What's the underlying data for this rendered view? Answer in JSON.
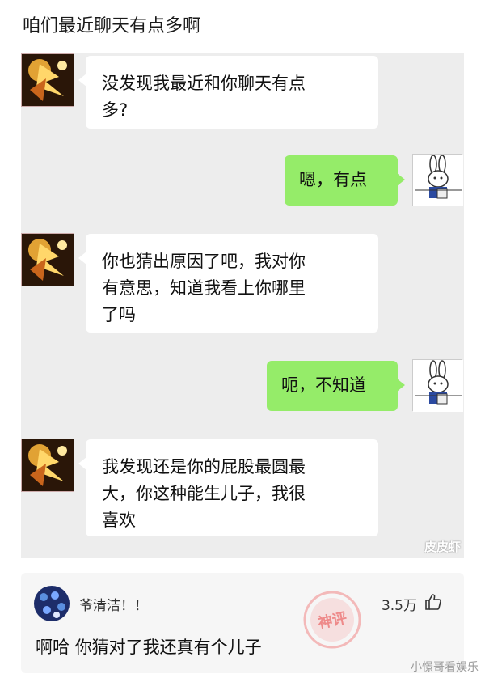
{
  "post": {
    "title": "咱们最近聊天有点多啊"
  },
  "chat": {
    "messages": [
      {
        "side": "left",
        "lines": [
          "没发现我最近和你聊天有点",
          "多?"
        ]
      },
      {
        "side": "right",
        "lines": [
          "嗯，有点"
        ]
      },
      {
        "side": "left",
        "lines": [
          "你也猜出原因了吧，我对你",
          "有意思，知道我看上你哪里",
          "了吗"
        ]
      },
      {
        "side": "right",
        "lines": [
          "呃，不知道"
        ]
      },
      {
        "side": "left",
        "lines": [
          "我发现还是你的屁股最圆最",
          "大，你这种能生儿子，我很",
          "喜欢"
        ]
      }
    ],
    "watermark": "皮皮虾"
  },
  "comment": {
    "username": "爷清洁！！",
    "likes": "3.5万",
    "text": "啊哈 你猜对了我还真有个儿子",
    "badge": "神评"
  },
  "footer": {
    "watermark": "小憬哥看娱乐"
  },
  "colors": {
    "green_bubble": "#95ec69",
    "chat_bg": "#ededed",
    "white_bubble": "#ffffff"
  }
}
